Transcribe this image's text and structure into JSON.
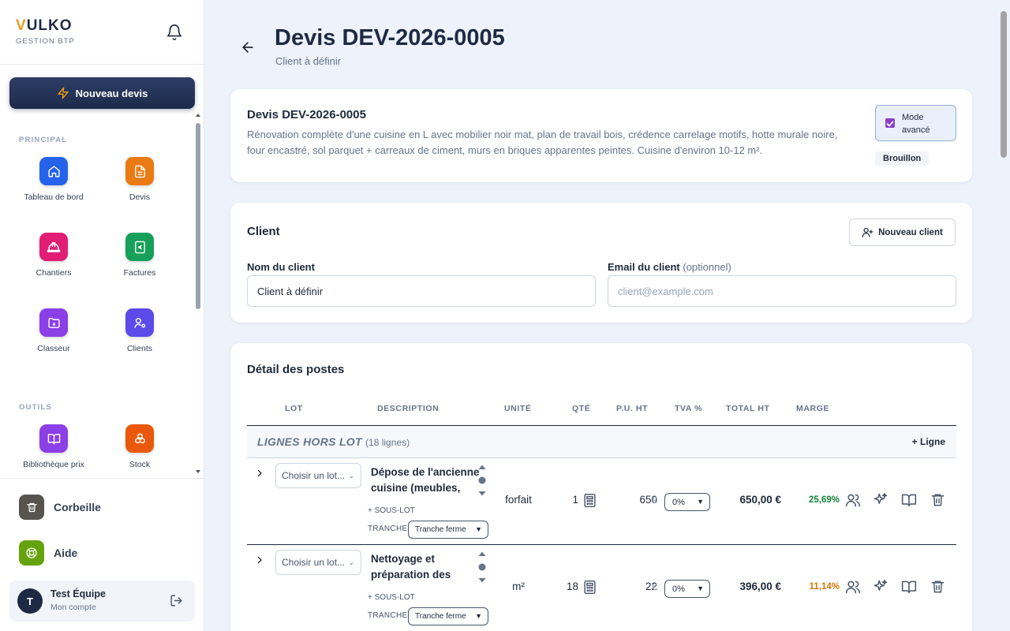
{
  "brand": {
    "initial": "V",
    "rest": "ULKO",
    "subtitle": "GESTION BTP"
  },
  "sidebar": {
    "new_quote_label": "Nouveau devis",
    "sections": {
      "principal": "PRINCIPAL",
      "outils": "OUTILS"
    },
    "items": [
      {
        "label": "Tableau de bord",
        "icon": "home-icon",
        "color": "#2563eb"
      },
      {
        "label": "Devis",
        "icon": "document-icon",
        "color": "#ea7a12"
      },
      {
        "label": "Chantiers",
        "icon": "hard-hat-icon",
        "color": "#e11d74"
      },
      {
        "label": "Factures",
        "icon": "invoice-euro-icon",
        "color": "#16a05a"
      },
      {
        "label": "Classeur",
        "icon": "folder-icon",
        "color": "#8b3fe6"
      },
      {
        "label": "Clients",
        "icon": "user-cog-icon",
        "color": "#5b4be8"
      },
      {
        "label": "Bibliothèque prix",
        "icon": "book-icon",
        "color": "#8b3fe6"
      },
      {
        "label": "Stock",
        "icon": "boxes-icon",
        "color": "#ea580c"
      }
    ],
    "bottom": [
      {
        "label": "Corbeille",
        "icon": "trash-icon",
        "color": "#57534e"
      },
      {
        "label": "Aide",
        "icon": "lifebuoy-icon",
        "color": "#65a30d"
      }
    ],
    "user": {
      "initial": "T",
      "name": "Test Équipe",
      "account": "Mon compte"
    }
  },
  "header": {
    "title": "Devis DEV-2026-0005",
    "subtitle": "Client à définir"
  },
  "summary": {
    "title": "Devis DEV-2026-0005",
    "description": "Rénovation complète d'une cuisine en L avec mobilier noir mat, plan de travail bois, crédence carrelage motifs, hotte murale noire, four encastré, sol parquet + carreaux de ciment, murs en briques apparentes peintes. Cuisine d'environ 10-12 m².",
    "mode_label": "Mode avancé",
    "mode_checked": true,
    "status": "Brouillon"
  },
  "client": {
    "title": "Client",
    "new_client_label": "Nouveau client",
    "name_label": "Nom du client",
    "name_value": "Client à définir",
    "email_label": "Email du client",
    "email_optional": "(optionnel)",
    "email_placeholder": "client@example.com"
  },
  "details": {
    "title": "Détail des postes",
    "columns": [
      "LOT",
      "DESCRIPTION",
      "UNITÉ",
      "QTÉ",
      "P.U. HT",
      "TVA %",
      "TOTAL HT",
      "MARGE"
    ],
    "group": {
      "name": "LIGNES HORS LOT",
      "count": "(18 lignes)",
      "add_label": "+ Ligne"
    },
    "rows": [
      {
        "lot_placeholder": "Choisir un lot...",
        "description": "Dépose de l'ancienne cuisine (meubles,",
        "sous_lot": "+ SOUS-LOT",
        "tranche_label": "TRANCHE",
        "tranche_value": "Tranche ferme",
        "unit": "forfait",
        "qty": "1",
        "pu": "650",
        "currency": "€",
        "tva": "0%",
        "total": "650,00 €",
        "marge": "25,69%",
        "marge_color": "#15803d"
      },
      {
        "lot_placeholder": "Choisir un lot...",
        "description": "Nettoyage et préparation des",
        "sous_lot": "+ SOUS-LOT",
        "tranche_label": "TRANCHE",
        "tranche_value": "Tranche ferme",
        "unit": "m²",
        "qty": "18",
        "pu": "22",
        "currency": "€",
        "tva": "0%",
        "total": "396,00 €",
        "marge": "11,14%",
        "marge_color": "#d97706"
      }
    ]
  }
}
